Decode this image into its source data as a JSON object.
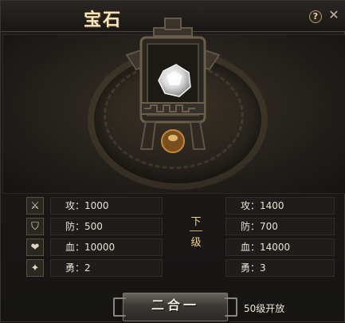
{
  "window": {
    "title": "宝石",
    "help_label": "?",
    "close_label": "✕"
  },
  "colors": {
    "title": "#f5e6c2",
    "panel_bg": "#1e1d1c",
    "accent_gold": "#f2d18a"
  },
  "current": {
    "attack": "攻：1000",
    "defense": "防：500",
    "hp": "血：10000",
    "courage": "勇：2"
  },
  "next": {
    "attack": "攻：1400",
    "defense": "防：700",
    "hp": "血：14000",
    "courage": "勇：3"
  },
  "stat_icons": {
    "attack": "crossed-swords-icon",
    "defense": "shield-icon",
    "hp": "heart-icon",
    "courage": "courage-icon"
  },
  "level_indicator": {
    "top": "下",
    "bottom": "级"
  },
  "merge_button_label": "二合一",
  "unlock_text": "50级开放"
}
